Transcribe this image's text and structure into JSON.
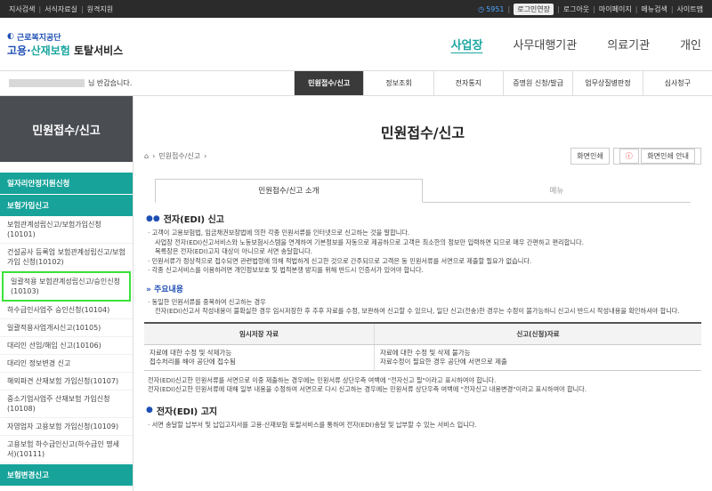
{
  "topbar": {
    "left": [
      "지사검색",
      "서식자료실",
      "원격지원"
    ],
    "timer": "5951",
    "extend": "로그인연장",
    "right": [
      "로그아웃",
      "마이페이지",
      "메뉴검색",
      "사이트맵"
    ]
  },
  "header": {
    "org": "근로복지공단",
    "svc_a": "고용·",
    "svc_b": "산재보험",
    "svc_c": " 토탈서비스",
    "nav": [
      "사업장",
      "사무대행기관",
      "의료기관",
      "개인"
    ]
  },
  "welcome": {
    "text": "님 반갑습니다.",
    "subnav": [
      "민원접수/신고",
      "정보조회",
      "전자통지",
      "증명원 신청/발급",
      "업무상질병판정",
      "심사청구"
    ]
  },
  "sidebar": {
    "title": "민원접수/신고",
    "cat1": "일자리안정지원신청",
    "cat2": "보험가입신고",
    "items": [
      "보험관계성립신고/보험가입신청(10101)",
      "건설공사 등록업 보험관계성립신고/보험가입 신청(10102)",
      "일괄적용 보험관계성립신고/승인신청(10103)",
      "하수급인사업주 승인신청(10104)",
      "일괄적용사업개시신고(10105)",
      "대리인 선임/해임 신고(10106)",
      "대리인 정보변경 신고",
      "해외파견 산재보험 가입신청(10107)",
      "중소기업사업주 산재보험 가입신청(10108)",
      "자영업자 고용보험 가입신청(10109)",
      "고용보험 하수급인신고(하수급인 명세서)(10111)"
    ],
    "cat3": "보험변경신고"
  },
  "content": {
    "title": "민원접수/신고",
    "breadcrumb": "민원접수/신고",
    "btn_print": "화면인쇄",
    "btn_guide": "화면인쇄 안내",
    "tab1": "민원접수/신고 소개",
    "tab2": "메뉴",
    "s1_title": "전자(EDI) 신고",
    "s1_p1": "· 고객이 고용보험법, 임금채권보장법에 의한 각종 민원서류를 인터넷으로 신고하는 것을 말합니다.",
    "s1_p2": "  사업장 전자(EDI)신고서비스와 노동보험시스템을 연계하여 기본정보를 자동으로 제공하므로 고객은 최소한의 정보만 입력하면 되므로 매우 간편하고 편리합니다.",
    "s1_p3": "  목록장은 전자(EDI)고지 대상이 아니므로 서면 송달합니다.",
    "s1_p4": "· 민원서류가 정상적으로 접수되면 관련법령에 의해 적법하게 신고한 것으로 간주되므로 고객은 동 민원서류를 서면으로 제출할 필요가 없습니다.",
    "s1_p5": "· 각종 신고서비스를 이용하려면 개인정보보호 및 법적분쟁 방지를 위해 반드시 인증서가 있어야 합니다.",
    "s2_title": "» 주요내용",
    "s2_p1": "· 동일한 민원서류를 중복하여 신고하는 경우",
    "s2_p2": "  전자(EDI)신고서 작성내용이 불확실한 경우 임시저장한 후 추후 자료를 수정, 보완하여 신고할 수 있으나, 일단 신고(전송)한 경우는 수정이 불가능하니 신고시 반드시 작성내용을 확인하셔야 합니다.",
    "table": {
      "headers": [
        "임시저장 자료",
        "신고(신청)자료"
      ],
      "rows": [
        [
          "자료에 대한 수정 및 삭제가능",
          "자료에 대한 수정 및 삭제 불가능"
        ],
        [
          "접수처리를 해야 공단에 접수됨",
          "자료수정이 필요한 경우 공단에 서면으로 제출"
        ]
      ]
    },
    "s2_p3": "전자(EDI)신고한 민원서류를 서면으로 이중 제출하는 경우에는 민원서류 상단우측 여백에 \"전자신고 필\"이라고 표시하여야 합니다.",
    "s2_p4": "전자(EDI)신고한 민원서류에 대해 일부 내용을 수정하여 서면으로 다시 신고하는 경우에는 민원서류 상단우측 여백에 \"전자신고 내용변경\"이라고 표시하여야 합니다.",
    "s3_title": "전자(EDI) 고지",
    "s3_p1": "· 서면 송달할 납부서 및 납입고지서를 고용·산재보험 토탈서비스를 통하여 전자(EDI)송달 및 납부할 수 있는 서비스 입니다."
  }
}
